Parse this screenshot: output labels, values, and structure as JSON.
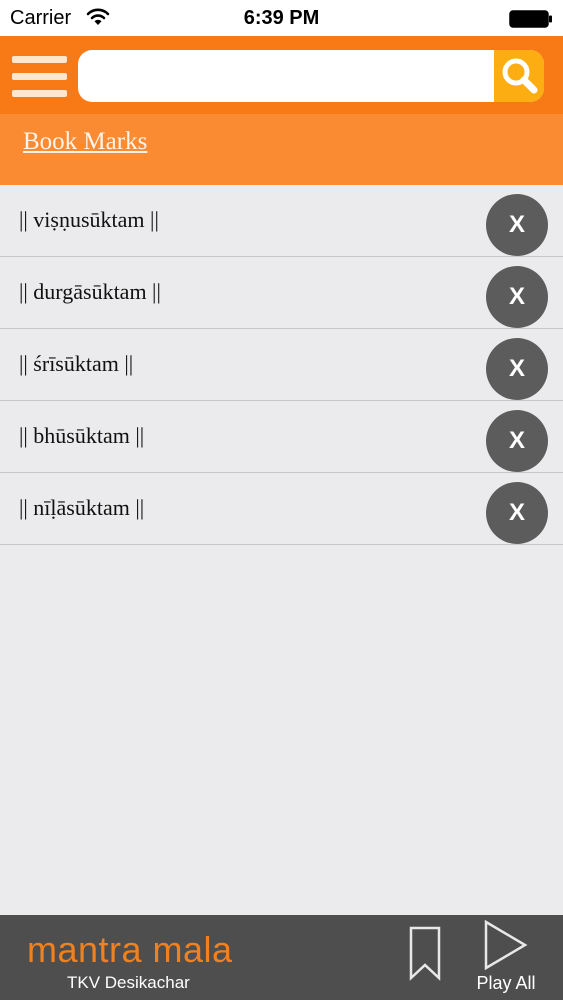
{
  "status_bar": {
    "carrier": "Carrier",
    "time": "6:39 PM"
  },
  "search": {
    "value": "",
    "placeholder": ""
  },
  "page": {
    "title": "Book Marks"
  },
  "bookmarks": [
    {
      "label": "|| viṣṇusūktam ||",
      "remove_label": "X"
    },
    {
      "label": "|| durgāsūktam ||",
      "remove_label": "X"
    },
    {
      "label": "|| śrīsūktam ||",
      "remove_label": "X"
    },
    {
      "label": "|| bhūsūktam ||",
      "remove_label": "X"
    },
    {
      "label": "|| nīḷāsūktam ||",
      "remove_label": "X"
    }
  ],
  "footer": {
    "app_name": "mantra mala",
    "author": "TKV Desikachar",
    "play_all_label": "Play All"
  },
  "icons": {
    "menu": "hamburger-icon",
    "search": "magnifier-icon",
    "bookmark": "bookmark-icon",
    "play": "play-triangle-icon",
    "wifi": "wifi-icon",
    "battery": "battery-icon"
  },
  "colors": {
    "header_orange": "#f77a17",
    "title_bar_orange": "#fb8b33",
    "search_button_yellow": "#fbad12",
    "brand_orange": "#f08120",
    "footer_gray": "#4e4e4e",
    "remove_button_gray": "#5c5c5c",
    "list_background": "#ebebed"
  }
}
